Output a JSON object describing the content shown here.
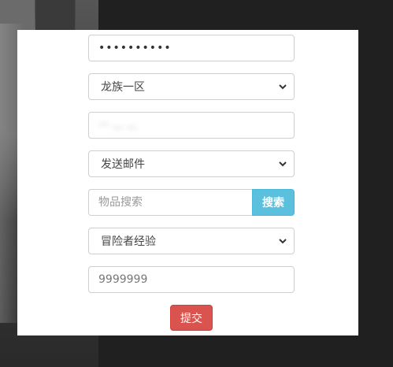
{
  "form": {
    "password_mask": "••••••••••",
    "server_select": {
      "selected": "龙族一区"
    },
    "account_field": {
      "value": "··· ... ..."
    },
    "action_select": {
      "selected": "发送邮件"
    },
    "item_search": {
      "placeholder": "物品搜索",
      "button_label": "搜索"
    },
    "item_select": {
      "selected": "冒险者经验"
    },
    "quantity_field": {
      "value": "9999999"
    },
    "submit_label": "提交"
  },
  "colors": {
    "search_button": "#5bc0de",
    "submit_button": "#d9534f",
    "page_background": "#202020",
    "panel_background": "#ffffff"
  },
  "icons": {
    "select_arrow": "chevron-down-icon"
  }
}
